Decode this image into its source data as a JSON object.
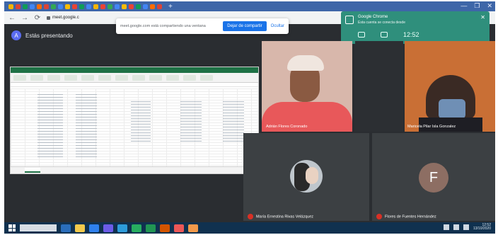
{
  "browser": {
    "tab_colors": [
      "#f4b400",
      "#db4437",
      "#0f9d58",
      "#4285f4",
      "#ff6d00",
      "#db4437",
      "#34a853",
      "#4285f4",
      "#fbbc04",
      "#ea4335",
      "#0f9d58",
      "#4285f4",
      "#f4b400",
      "#ea4335",
      "#34a853",
      "#4285f4",
      "#fbbc04",
      "#ea4335",
      "#0f9d58",
      "#4285f4",
      "#ff6d00",
      "#db4437"
    ],
    "new_tab_icon": "+",
    "minimize_icon": "—",
    "maximize_icon": "❐",
    "close_icon": "✕",
    "back_icon": "←",
    "forward_icon": "→",
    "reload_icon": "⟳",
    "url": "meet.google.c"
  },
  "share_bar": {
    "text": "meet.google.com está compartiendo una ventana",
    "stop_label": "Dejar de compartir",
    "hide_label": "Ocultar"
  },
  "presenting": {
    "avatar_letter": "A",
    "label": "Estás presentando"
  },
  "toast": {
    "title": "Google Chrome",
    "subtitle": "Esta cuenta se conecta desde",
    "close_icon": "✕",
    "time": "12:52",
    "people_icon": "people-icon",
    "chat_icon": "chat-icon"
  },
  "participants": [
    {
      "name": "Adrián Flores Coronado"
    },
    {
      "name": "Maricela Pilar Isla Gonzalez"
    },
    {
      "name": "María Ernestina Rivas Velázquez"
    },
    {
      "name": "Flores de Fuentes Hernández",
      "avatar_letter": "F"
    }
  ],
  "taskbar": {
    "app_colors": [
      "#2a6ebb",
      "#f2c94c",
      "#2f80ed",
      "#6c5ce7",
      "#2d9cdb",
      "#27ae60",
      "#219653",
      "#d35400",
      "#eb5757",
      "#f2994a"
    ],
    "time": "12:52",
    "date": "13/10/2020"
  }
}
